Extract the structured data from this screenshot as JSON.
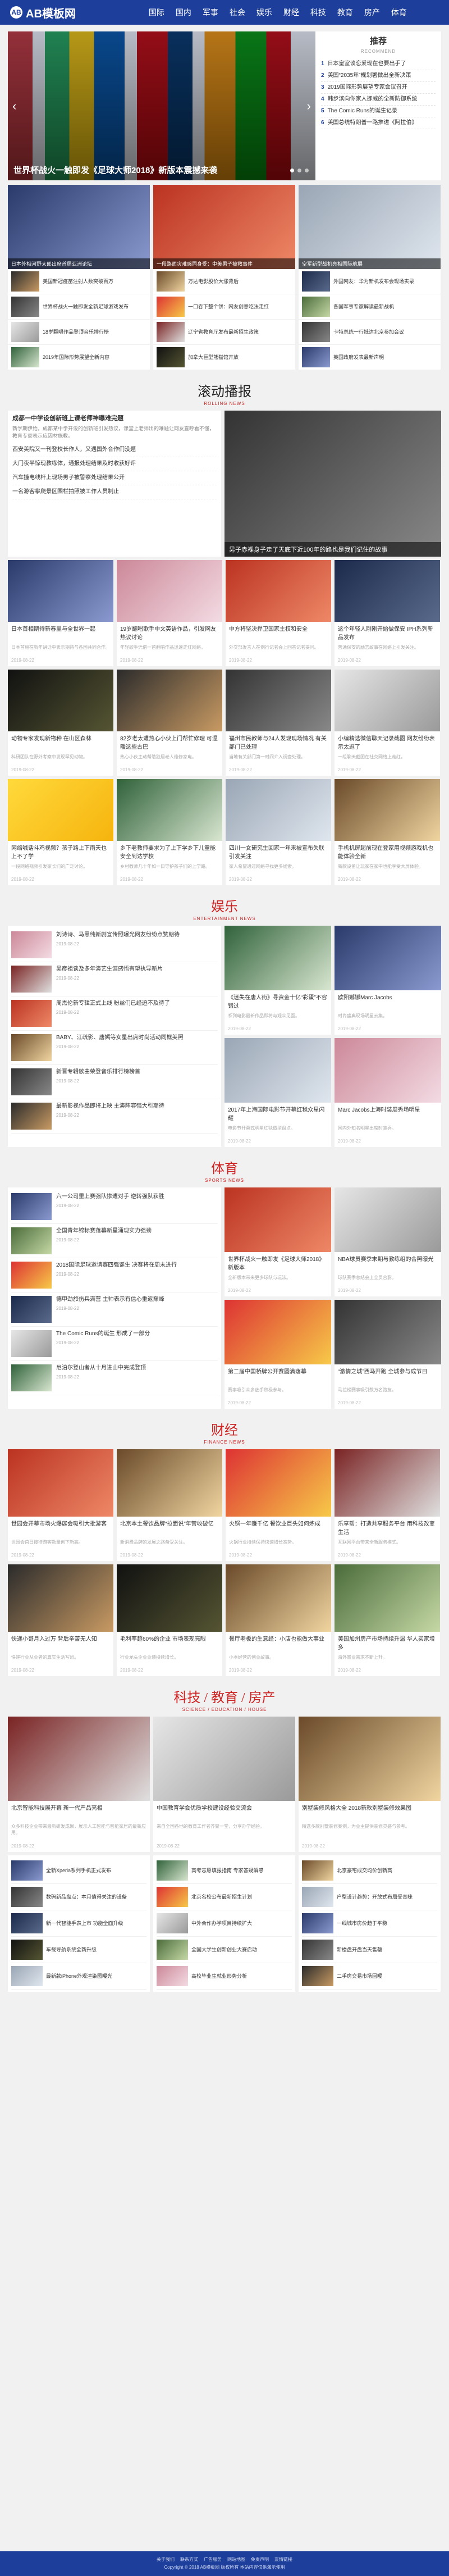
{
  "header": {
    "logo_text": "AB模板网",
    "logo_mark": "AB",
    "nav": [
      "国际",
      "国内",
      "军事",
      "社会",
      "娱乐",
      "财经",
      "科技",
      "教育",
      "房产",
      "体育"
    ]
  },
  "slider": {
    "caption": "世界杯战火一触即发《足球大师2018》新版本震撼来袭"
  },
  "recommend": {
    "title": "推荐",
    "subtitle": "RECOMMEND",
    "items": [
      "日本皇室谈恋爱现在也要出手了",
      "美国“2035年”规划署做出全新决策",
      "2019国际形势展望专家会议召开",
      "韩步滨向你家人挪威的全新防御系统",
      "The Comic Runs的诞生记录",
      "美国总统特朗普一路推进《阿拉伯》"
    ]
  },
  "top_cols": [
    {
      "hero_caption": "日本外相河野太郎出席首届亚洲论坛",
      "items": [
        "美国新冠疫苗注射人数突破百万",
        "世界杯战火一触即发全新足球游戏发布",
        "18岁翻唱作品登顶音乐排行榜",
        "2019年国际形势展望全新内容"
      ]
    },
    {
      "hero_caption": "一段路面灾难感同身受：中美男子被救事件",
      "items": [
        "万达电影股价大涨背后",
        "一口吞下整个饼：网友创意吃法走红",
        "辽宁省教育厅发布最新招生政策",
        "加拿大巨型熊猫馆开放"
      ]
    },
    {
      "hero_caption": "空军新型战机亮相国际航展",
      "items": [
        "外国网友：华为新机发布会现场实录",
        "各国军事专家解读最新战机",
        "卡特总统一行抵达北京参加会议",
        "英国政府发表最新声明"
      ]
    }
  ],
  "gundong": {
    "title": "滚动播报",
    "subtitle": "ROLLING NEWS",
    "lead": "成都一中学设创新班上课老师神曝难完题",
    "lead_desc": "新学期伊始，成都某中学开设的创新班引发热议，课堂上老师出的难题让网友直呼看不懂，教育专家表示应因材施教。",
    "rows": [
      "西安美院又一刊登校长作人，又遇国外合作们没题",
      "大门夜半惊现教练体，通报处理结果及时收获好评",
      "汽车撞电线杆上现场男子被警察处理结果公开",
      "一名游客攀爬景区围栏拍照被工作人员制止"
    ],
    "image_caption": "男子赤裸身子走了天底下近100年的路也是我们记住的故事"
  },
  "gun_cards": [
    {
      "t": "日本首相期待新春里与全世界一起",
      "d": "日本首相在新年讲话中表示期待与各国共同合作。",
      "m": "2019-08-22"
    },
    {
      "t": "19岁翻唱歌手中文英语作品，引发网友热议讨论",
      "d": "年轻歌手凭借一首翻唱作品迅速走红网络。",
      "m": "2019-08-22"
    },
    {
      "t": "中方将坚决捍卫国家主权和安全",
      "d": "外交部发言人在例行记者会上回答记者提问。",
      "m": "2019-08-22"
    },
    {
      "t": "这个年轻人刚刚开始做保安 IPH系列新品发布",
      "d": "普通保安的励志故事在网络上引发关注。",
      "m": "2019-08-22"
    },
    {
      "t": "动物专家发现新物种 在山区森林",
      "d": "科研团队在野外考察中发现罕见动物。",
      "m": "2019-08-22"
    },
    {
      "t": "82岁老太遭热心小伙上门帮忙修理 可温暖这些古巴",
      "d": "热心小伙主动帮助独居老人维修家电。",
      "m": "2019-08-22"
    },
    {
      "t": "福州市民教师与24人发现现场情况 有关部门已处理",
      "d": "当地有关部门第一时间介入调查处理。",
      "m": "2019-08-22"
    },
    {
      "t": "小编精选微信聊天记录截图 网友纷纷表示太逗了",
      "d": "一组聊天截图在社交网络上走红。",
      "m": "2019-08-22"
    },
    {
      "t": "网络喊话斗鸡视频？孩子路上下雨天也上不了学",
      "d": "一段网络视频引发家长们的广泛讨论。",
      "m": "2019-08-22"
    },
    {
      "t": "乡下老教师要求为了上下学乡下儿童能安全到达学校",
      "d": "乡村教师几十年如一日守护孩子们的上学路。",
      "m": "2019-08-22"
    },
    {
      "t": "四川一女研究生回家一年来被宣布失联引发关注",
      "d": "家人希望通过网络寻找更多线索。",
      "m": "2019-08-22"
    },
    {
      "t": "手机机屏超前现在登家用视频游戏机也能体验全新",
      "d": "新款设备让玩家在家中也能享受大屏体验。",
      "m": "2019-08-22"
    }
  ],
  "entertainment": {
    "title": "娱乐",
    "subtitle": "ENTERTAINMENT NEWS",
    "list": [
      {
        "t": "刘诗诗、马思纯新剧宣传照曝光网友纷纷点赞期待",
        "m": "2019-08-22"
      },
      {
        "t": "吴彦祖谈及多年演艺生涯感悟有望执导新片",
        "m": "2019-08-22"
      },
      {
        "t": "周杰伦新专辑正式上线 粉丝们已经迫不及待了",
        "m": "2019-08-22"
      },
      {
        "t": "BABY、江疏影、唐嫣等女星出席时尚活动同框美照",
        "m": "2019-08-22"
      },
      {
        "t": "新晋专辑歌曲荣登音乐排行榜榜首",
        "m": "2019-08-22"
      },
      {
        "t": "最新影视作品即将上映 主演阵容强大引期待",
        "m": "2019-08-22"
      }
    ],
    "cards": [
      {
        "t": "《迷失在唐人街》寻资金十亿“彩蛋”不容错过",
        "d": "系列电影最新作品即将与观众见面。",
        "m": "2019-08-22"
      },
      {
        "t": "欧阳娜娜Marc Jacobs",
        "d": "时尚盛典现场明星云集。",
        "m": "2019-08-22"
      },
      {
        "t": "2017年上海国际电影节开幕红毯众星闪耀",
        "d": "电影节开幕式明星红毯造型盘点。",
        "m": "2019-08-22"
      },
      {
        "t": "Marc Jacobs上海时装周秀场明星",
        "d": "国内外知名明星出席时装秀。",
        "m": "2019-08-22"
      }
    ]
  },
  "sports": {
    "title": "体育",
    "subtitle": "SPORTS NEWS",
    "list": [
      {
        "t": "六一公司里上赛强队惨遭对手 逆转强队获胜",
        "m": "2019-08-22"
      },
      {
        "t": "全国青年锦标赛落幕新星涌现实力强劲",
        "m": "2019-08-22"
      },
      {
        "t": "2018国际足球邀请赛四强诞生 决赛将在周末进行",
        "m": "2019-08-22"
      },
      {
        "t": "德甲劲旅伤兵满营 主帅表示有信心重返巅峰",
        "m": "2019-08-22"
      },
      {
        "t": "The Comic Runs的诞生 形成了一部分",
        "m": "2019-08-22"
      },
      {
        "t": "尼泊尔登山者从十月进山中完成登顶",
        "m": "2019-08-22"
      }
    ],
    "cards": [
      {
        "t": "世界杯战火一触即发《足球大师2018》新版本",
        "d": "全新版本带来更多球队与玩法。",
        "m": "2019-08-22"
      },
      {
        "t": "NBA球员赛季末期与教练组的合照曝光",
        "d": "球队赛季总结会上全员合影。",
        "m": "2019-08-22"
      },
      {
        "t": "第二届中国桥牌公开赛圆满落幕",
        "d": "赛事吸引众多选手积极参与。",
        "m": "2019-08-22"
      },
      {
        "t": "“激情之城”西马开跑 全城参与成节日",
        "d": "马拉松赛事吸引数万名跑友。",
        "m": "2019-08-22"
      }
    ]
  },
  "finance": {
    "title": "财经",
    "subtitle": "FINANCE NEWS",
    "cards": [
      {
        "t": "世园会开幕市场火爆展会吸引大批游客",
        "d": "世园会首日接待游客数量创下新高。",
        "m": "2019-08-22"
      },
      {
        "t": "北京本土餐饮品牌“拉面说”年营收破亿",
        "d": "新消费品牌的发展之路备受关注。",
        "m": "2019-08-22"
      },
      {
        "t": "火锅一年赚千亿 餐饮业巨头如何炼成",
        "d": "火锅行业持续保持快速增长态势。",
        "m": "2019-08-22"
      },
      {
        "t": "乐享帮：打造共享服务平台 用科技改变生活",
        "d": "互联网平台带来全新服务模式。",
        "m": "2019-08-22"
      },
      {
        "t": "快递小哥月入过万 背后辛苦无人知",
        "d": "快递行业从业者的真实生活写照。",
        "m": "2019-08-22"
      },
      {
        "t": "毛利率超60%的企业 市场表现亮眼",
        "d": "行业龙头企业业绩持续增长。",
        "m": "2019-08-22"
      },
      {
        "t": "餐厅老板的生意经：小店也能做大事业",
        "d": "小本经营的创业故事。",
        "m": "2019-08-22"
      },
      {
        "t": "美国加州房产市场持续升温 华人买家增多",
        "d": "海外置业需求不断上升。",
        "m": "2019-08-22"
      }
    ]
  },
  "science": {
    "title": "科技 / 教育 / 房产",
    "subtitle": "SCIENCE / EDUCATION / HOUSE",
    "cards": [
      {
        "t": "北京智能科技展开幕 新一代产品亮相",
        "d": "众多科技企业带来最新研发成果，展示人工智能与智能家居的最新应用。",
        "m": "2019-08-22"
      },
      {
        "t": "中国教育学会优质学校建设经验交流会",
        "d": "来自全国各地的教育工作者齐聚一堂，分享办学经验。",
        "m": "2019-08-22"
      },
      {
        "t": "别墅装修风格大全 2018新款别墅装修效果图",
        "d": "精选多款别墅装修案例，为业主提供装修灵感与参考。",
        "m": "2019-08-22"
      }
    ],
    "lists": [
      [
        "全新Xperia系列手机正式发布",
        "数码新品盘点：本月值得关注的设备",
        "新一代智能手表上市 功能全面升级",
        "车载导航系统全新升级",
        "最新款iPhone外观渲染图曝光"
      ],
      [
        "高考志愿填报指南 专家答疑解惑",
        "北京名校公布最新招生计划",
        "中外合作办学项目持续扩大",
        "全国大学生创新创业大赛启动",
        "高校毕业生就业形势分析"
      ],
      [
        "北京豪宅成交均价创新高",
        "户型设计趋势：开放式布局受青睐",
        "一线城市房价趋于平稳",
        "新楼盘开盘当天售罄",
        "二手房交易市场回暖"
      ]
    ]
  },
  "footer": {
    "links": [
      "关于我们",
      "联系方式",
      "广告服务",
      "网站地图",
      "免责声明",
      "友情链接"
    ],
    "copyright": "Copyright © 2018 AB模板网 版权所有 本站内容仅供演示使用"
  }
}
